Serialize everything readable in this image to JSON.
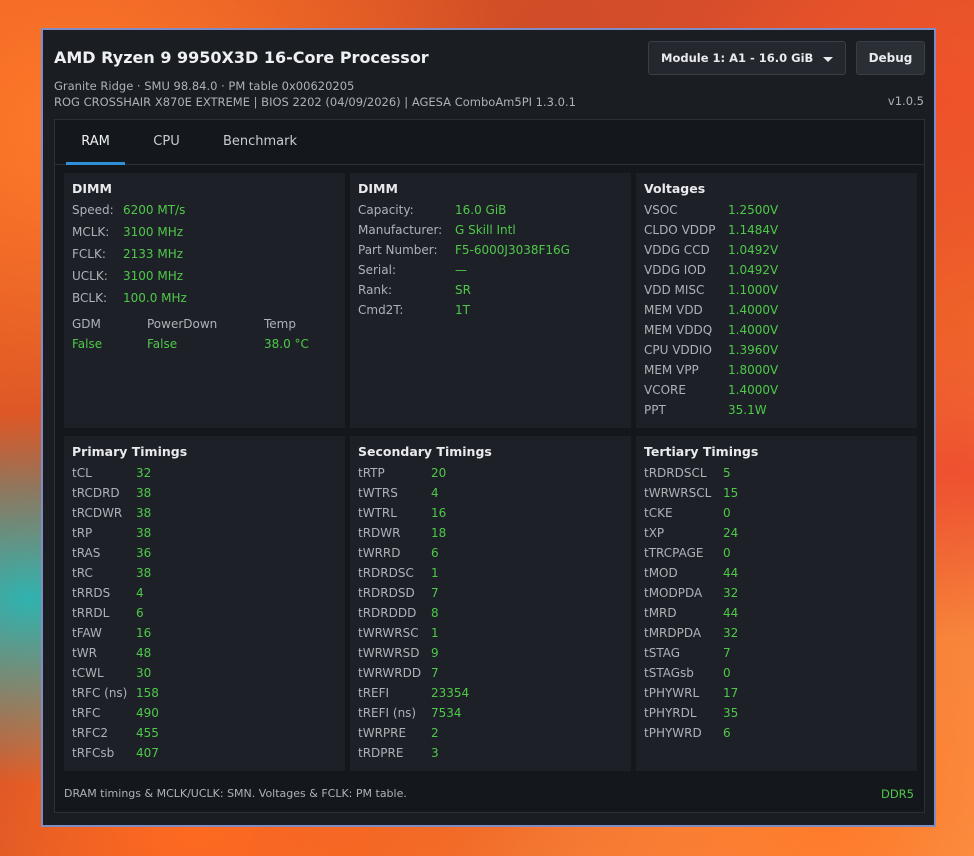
{
  "header": {
    "cpu_name": "AMD Ryzen 9 9950X3D 16-Core Processor",
    "info_line_1": "Granite Ridge  ·  SMU 98.84.0  ·  PM table 0x00620205",
    "info_line_2": "ROG CROSSHAIR X870E EXTREME | BIOS 2202 (04/09/2026) | AGESA  ComboAm5PI 1.3.0.1",
    "version": "v1.0.5",
    "module_select": "Module 1: A1 - 16.0 GiB",
    "debug_label": "Debug"
  },
  "tabs": [
    {
      "label": "RAM",
      "active": true
    },
    {
      "label": "CPU",
      "active": false
    },
    {
      "label": "Benchmark",
      "active": false
    }
  ],
  "dimm_clocks": {
    "title": "DIMM",
    "rows": [
      {
        "label": "Speed:",
        "value": "6200 MT/s"
      },
      {
        "label": "MCLK:",
        "value": "3100 MHz"
      },
      {
        "label": "FCLK:",
        "value": "2133 MHz"
      },
      {
        "label": "UCLK:",
        "value": "3100 MHz"
      },
      {
        "label": "BCLK:",
        "value": "100.0 MHz"
      }
    ],
    "flags": [
      {
        "label": "GDM",
        "value": "False"
      },
      {
        "label": "PowerDown",
        "value": "False"
      },
      {
        "label": "Temp",
        "value": "38.0 °C"
      }
    ]
  },
  "dimm_info": {
    "title": "DIMM",
    "rows": [
      {
        "label": "Capacity:",
        "value": "16.0 GiB"
      },
      {
        "label": "Manufacturer:",
        "value": "G Skill Intl"
      },
      {
        "label": "Part Number:",
        "value": "F5-6000J3038F16G"
      },
      {
        "label": "Serial:",
        "value": "—"
      },
      {
        "label": "Rank:",
        "value": "SR"
      },
      {
        "label": "Cmd2T:",
        "value": "1T"
      }
    ]
  },
  "voltages": {
    "title": "Voltages",
    "rows": [
      {
        "label": "VSOC",
        "value": "1.2500V"
      },
      {
        "label": "CLDO VDDP",
        "value": "1.1484V"
      },
      {
        "label": "VDDG CCD",
        "value": "1.0492V"
      },
      {
        "label": "VDDG IOD",
        "value": "1.0492V"
      },
      {
        "label": "VDD MISC",
        "value": "1.1000V"
      },
      {
        "label": "MEM VDD",
        "value": "1.4000V"
      },
      {
        "label": "MEM VDDQ",
        "value": "1.4000V"
      },
      {
        "label": "CPU VDDIO",
        "value": "1.3960V"
      },
      {
        "label": "MEM VPP",
        "value": "1.8000V"
      },
      {
        "label": "VCORE",
        "value": "1.4000V"
      },
      {
        "label": "PPT",
        "value": "35.1W"
      }
    ]
  },
  "primary": {
    "title": "Primary Timings",
    "rows": [
      {
        "label": "tCL",
        "value": "32"
      },
      {
        "label": "tRCDRD",
        "value": "38"
      },
      {
        "label": "tRCDWR",
        "value": "38"
      },
      {
        "label": "tRP",
        "value": "38"
      },
      {
        "label": "tRAS",
        "value": "36"
      },
      {
        "label": "tRC",
        "value": "38"
      },
      {
        "label": "tRRDS",
        "value": "4"
      },
      {
        "label": "tRRDL",
        "value": "6"
      },
      {
        "label": "tFAW",
        "value": "16"
      },
      {
        "label": "tWR",
        "value": "48"
      },
      {
        "label": "tCWL",
        "value": "30"
      },
      {
        "label": "tRFC (ns)",
        "value": "158"
      },
      {
        "label": "tRFC",
        "value": "490"
      },
      {
        "label": "tRFC2",
        "value": "455"
      },
      {
        "label": "tRFCsb",
        "value": "407"
      }
    ]
  },
  "secondary": {
    "title": "Secondary Timings",
    "rows": [
      {
        "label": "tRTP",
        "value": "20"
      },
      {
        "label": "tWTRS",
        "value": "4"
      },
      {
        "label": "tWTRL",
        "value": "16"
      },
      {
        "label": "tRDWR",
        "value": "18"
      },
      {
        "label": "tWRRD",
        "value": "6"
      },
      {
        "label": "tRDRDSC",
        "value": "1"
      },
      {
        "label": "tRDRDSD",
        "value": "7"
      },
      {
        "label": "tRDRDDD",
        "value": "8"
      },
      {
        "label": "tWRWRSC",
        "value": "1"
      },
      {
        "label": "tWRWRSD",
        "value": "9"
      },
      {
        "label": "tWRWRDD",
        "value": "7"
      },
      {
        "label": "tREFI",
        "value": "23354"
      },
      {
        "label": "tREFI (ns)",
        "value": "7534"
      },
      {
        "label": "tWRPRE",
        "value": "2"
      },
      {
        "label": "tRDPRE",
        "value": "3"
      }
    ]
  },
  "tertiary": {
    "title": "Tertiary Timings",
    "rows": [
      {
        "label": "tRDRDSCL",
        "value": "5"
      },
      {
        "label": "tWRWRSCL",
        "value": "15"
      },
      {
        "label": "tCKE",
        "value": "0"
      },
      {
        "label": "tXP",
        "value": "24"
      },
      {
        "label": "tTRCPAGE",
        "value": "0"
      },
      {
        "label": "tMOD",
        "value": "44"
      },
      {
        "label": "tMODPDA",
        "value": "32"
      },
      {
        "label": "tMRD",
        "value": "44"
      },
      {
        "label": "tMRDPDA",
        "value": "32"
      },
      {
        "label": "tSTAG",
        "value": "7"
      },
      {
        "label": "tSTAGsb",
        "value": "0"
      },
      {
        "label": "tPHYWRL",
        "value": "17"
      },
      {
        "label": "tPHYRDL",
        "value": "35"
      },
      {
        "label": "tPHYWRD",
        "value": "6"
      }
    ]
  },
  "footer": {
    "note": "DRAM timings & MCLK/UCLK: SMN. Voltages & FCLK: PM table.",
    "memory_type": "DDR5"
  },
  "colors": {
    "value_green": "#4fc84a",
    "tab_accent": "#2f8fd8",
    "window_border": "#7f8cc6"
  }
}
